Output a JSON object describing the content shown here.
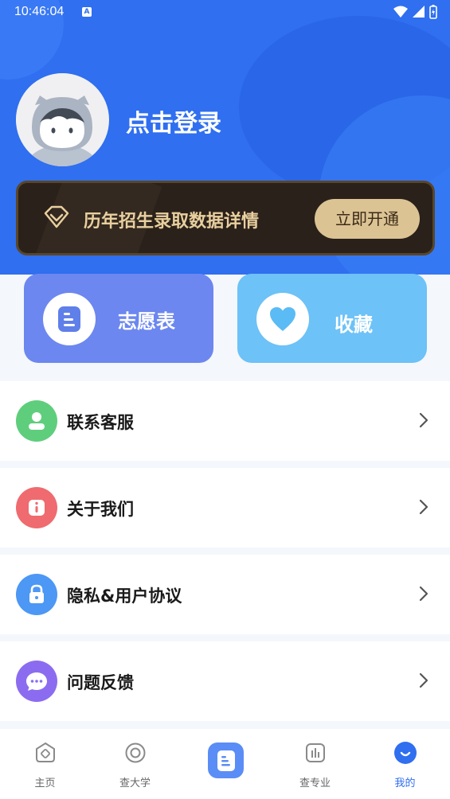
{
  "status_bar": {
    "time": "10:46:04",
    "notif_icon": "a-icon"
  },
  "header": {
    "login_text": "点击登录"
  },
  "vip": {
    "text": "历年招生录取数据详情",
    "button": "立即开通"
  },
  "quick_actions": [
    {
      "label": "志愿表",
      "icon": "document-icon"
    },
    {
      "label": "收藏",
      "icon": "heart-icon"
    }
  ],
  "menu": [
    {
      "label": "联系客服",
      "icon": "user-icon",
      "color": "#5fce7c"
    },
    {
      "label": "关于我们",
      "icon": "info-icon",
      "color": "#ef6b6f"
    },
    {
      "label": "隐私&用户协议",
      "icon": "lock-icon",
      "color": "#4d97f5"
    },
    {
      "label": "问题反馈",
      "icon": "chat-icon",
      "color": "#8b6cf0"
    }
  ],
  "tabbar": {
    "items": [
      {
        "label": "主页",
        "icon": "home-icon"
      },
      {
        "label": "查大学",
        "icon": "university-icon"
      },
      {
        "label": "",
        "icon": "document-icon"
      },
      {
        "label": "查专业",
        "icon": "chart-icon"
      },
      {
        "label": "我的",
        "icon": "profile-icon"
      }
    ],
    "active_index": 4,
    "accent": "#2f6ff0"
  }
}
